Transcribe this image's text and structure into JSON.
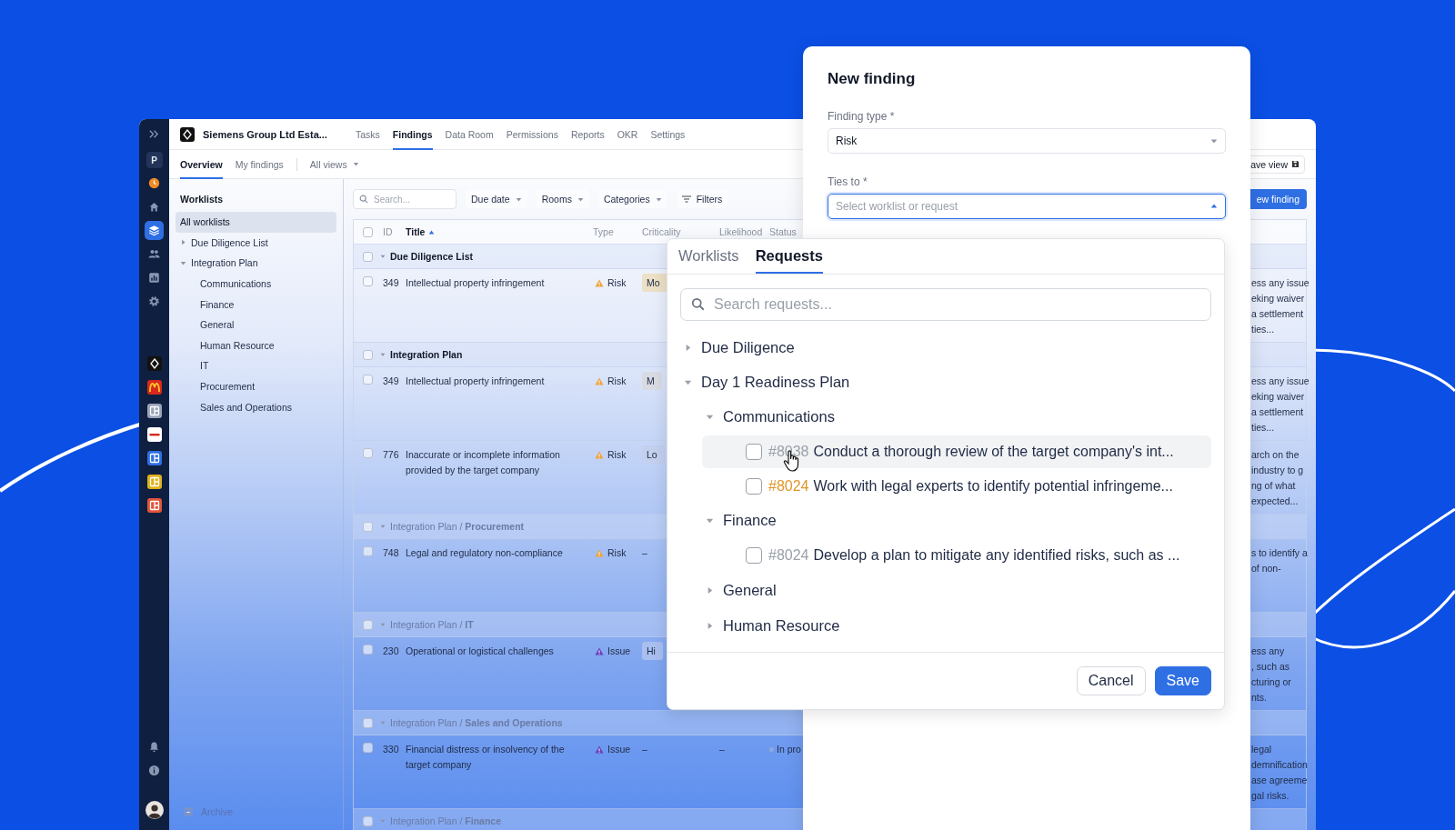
{
  "rail": {
    "avatar_letter": "P",
    "nav": [
      {
        "kind": "clock",
        "selected": false
      },
      {
        "kind": "home",
        "selected": false
      },
      {
        "kind": "layers",
        "selected": true
      },
      {
        "kind": "people",
        "selected": false
      },
      {
        "kind": "chart",
        "selected": false
      },
      {
        "kind": "gear",
        "selected": false
      }
    ],
    "workspaces": [
      {
        "kind": "diamond",
        "color": "#111111"
      },
      {
        "kind": "arch",
        "color": "#d8281c"
      },
      {
        "kind": "grid",
        "color": "#9aa4b8"
      },
      {
        "kind": "wordmark",
        "color": "#ffffff"
      },
      {
        "kind": "grid",
        "color": "#2f6fe4"
      },
      {
        "kind": "grid",
        "color": "#e0b21c"
      },
      {
        "kind": "grid",
        "color": "#e2553b"
      }
    ]
  },
  "workspace": "Siemens Group Ltd Esta...",
  "nav": [
    {
      "label": "Tasks",
      "selected": false
    },
    {
      "label": "Findings",
      "selected": true
    },
    {
      "label": "Data Room",
      "selected": false
    },
    {
      "label": "Permissions",
      "selected": false
    },
    {
      "label": "Reports",
      "selected": false
    },
    {
      "label": "OKR",
      "selected": false
    },
    {
      "label": "Settings",
      "selected": false
    }
  ],
  "subtabs": [
    {
      "label": "Overview",
      "selected": true
    },
    {
      "label": "My findings",
      "selected": false
    }
  ],
  "views": "All views",
  "save_view": "ave view",
  "worklists": {
    "title": "Worklists",
    "archive": "Archive",
    "items": [
      {
        "label": "All worklists",
        "selected": true
      },
      {
        "label": "Due Diligence List",
        "selected": false,
        "expanded": false
      },
      {
        "label": "Integration Plan",
        "selected": false,
        "expanded": true,
        "children": [
          {
            "label": "Communications",
            "selected": false
          },
          {
            "label": "Finance",
            "selected": false
          },
          {
            "label": "General",
            "selected": false
          },
          {
            "label": "Human Resource",
            "selected": false
          },
          {
            "label": "IT",
            "selected": false
          },
          {
            "label": "Procurement",
            "selected": false
          },
          {
            "label": "Sales and Operations",
            "selected": false
          }
        ]
      }
    ]
  },
  "toolbar": {
    "search_placeholder": "Search...",
    "filters": [
      "Due date",
      "Rooms",
      "Categories"
    ],
    "filters_button": "Filters",
    "new_button": "ew finding"
  },
  "table": {
    "header_checked": false,
    "columns": [
      {
        "label": "ID"
      },
      {
        "label": "Title",
        "sorted": true
      },
      {
        "label": "Type"
      },
      {
        "label": "Criticality"
      },
      {
        "label": "Likelihood"
      },
      {
        "label": "Status"
      }
    ],
    "rows": [
      {
        "kind": "group",
        "checked": false,
        "label": "Due Diligence List"
      },
      {
        "kind": "finding",
        "checked": false,
        "id": "349",
        "title": "Intellectual property infringement",
        "type": {
          "kind": "risk",
          "text": "Risk"
        },
        "criticality": {
          "text": "Mo",
          "color": "#ece0c6"
        },
        "description": [
          "ess any issue",
          "eking waiver",
          "a settlement",
          "ties..."
        ]
      },
      {
        "kind": "group",
        "checked": false,
        "label": "Integration Plan"
      },
      {
        "kind": "finding",
        "checked": false,
        "id": "349",
        "title": "Intellectual property infringement",
        "type": {
          "kind": "risk",
          "text": "Risk"
        },
        "criticality": {
          "text": "M",
          "color": "#d9dbe3"
        },
        "description": [
          "ess any issue",
          "eking waiver",
          "a settlement",
          "ties..."
        ]
      },
      {
        "kind": "finding",
        "checked": false,
        "id": "776",
        "title": "Inaccurate or incomplete information provided by the target company",
        "type": {
          "kind": "risk",
          "text": "Risk"
        },
        "criticality": {
          "text": "Lo",
          "color": "#c3d0ee"
        },
        "description": [
          "arch on the",
          "industry to g",
          "ng of what",
          "expected..."
        ]
      },
      {
        "kind": "subgroup",
        "checked": false,
        "label": "Integration Plan / **Procurement**"
      },
      {
        "kind": "finding",
        "checked": false,
        "id": "748",
        "title": "Legal and regulatory non-compliance",
        "type": {
          "kind": "risk",
          "text": "Risk"
        },
        "criticality": {
          "text": "–"
        },
        "description": [
          "s to identify a",
          "of non-"
        ]
      },
      {
        "kind": "subgroup",
        "checked": false,
        "label": "Integration Plan / **IT**"
      },
      {
        "kind": "finding",
        "checked": false,
        "id": "230",
        "title": "Operational or logistical challenges",
        "type": {
          "kind": "issue",
          "text": "Issue"
        },
        "criticality": {
          "text": "Hi",
          "color": "#a9bff0"
        },
        "description": [
          "ess any",
          ", such as",
          "cturing or",
          "nts."
        ]
      },
      {
        "kind": "subgroup",
        "checked": false,
        "label": "Integration Plan / **Sales and Operations**"
      },
      {
        "kind": "finding",
        "checked": false,
        "id": "330",
        "title": "Financial distress or insolvency of the target company",
        "type": {
          "kind": "issue",
          "text": "Issue"
        },
        "criticality": {
          "text": "–"
        },
        "likelihood": "–",
        "status": {
          "text": "In pro",
          "color": "#8fa9dc"
        },
        "description": [
          "legal",
          "demnification",
          "ase agreeme",
          "gal risks."
        ]
      },
      {
        "kind": "subgroup",
        "checked": false,
        "label": "Integration Plan / **Finance**"
      }
    ]
  },
  "modal": {
    "title": "New finding",
    "fields": [
      {
        "label": "Finding type *",
        "value": "Risk",
        "focused": false
      },
      {
        "label": "Ties to *",
        "placeholder": "Select worklist or request",
        "focused": true
      }
    ]
  },
  "dropdown": {
    "tabs": [
      {
        "label": "Worklists",
        "selected": false
      },
      {
        "label": "Requests",
        "selected": true
      }
    ],
    "search_placeholder": "Search requests...",
    "tree": [
      {
        "label": "Due Diligence",
        "expanded": false
      },
      {
        "label": "Day 1 Readiness Plan",
        "expanded": true,
        "children": [
          {
            "label": "Communications",
            "expanded": true,
            "children": [
              {
                "kind": "request",
                "number": "#8038",
                "color": "#9aa0aa",
                "text": "Conduct a thorough review of the target company's int...",
                "checked": false,
                "highlighted": true
              },
              {
                "kind": "request",
                "number": "#8024",
                "color": "#e0962a",
                "text": "Work with legal experts to identify potential infringeme...",
                "checked": false,
                "highlighted": false
              }
            ]
          },
          {
            "label": "Finance",
            "expanded": true,
            "children": [
              {
                "kind": "request",
                "number": "#8024",
                "color": "#9aa0aa",
                "text": "Develop a plan to mitigate any identified risks, such as ...",
                "checked": false,
                "highlighted": false
              }
            ]
          },
          {
            "label": "General",
            "expanded": false
          },
          {
            "label": "Human Resource",
            "expanded": false
          }
        ]
      }
    ],
    "buttons": [
      {
        "kind": "secondary",
        "label": "Cancel"
      },
      {
        "kind": "primary",
        "label": "Save"
      }
    ]
  }
}
